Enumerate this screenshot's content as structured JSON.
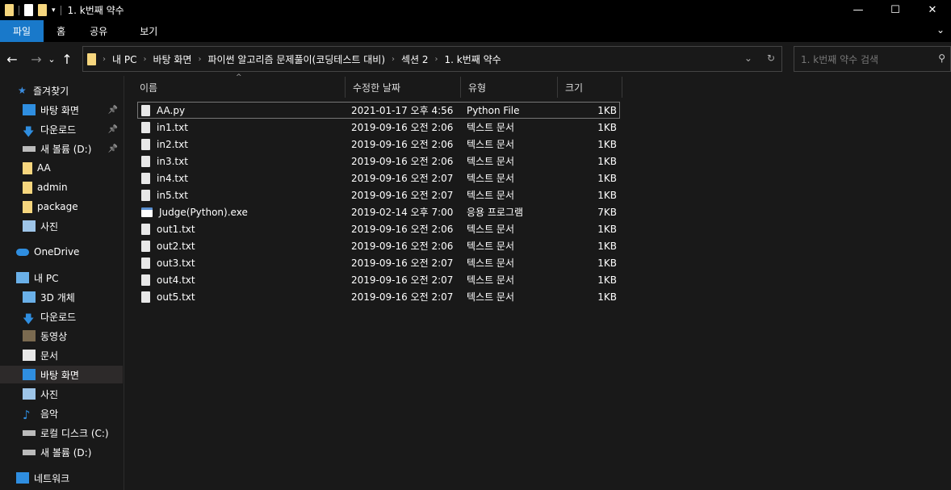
{
  "window": {
    "title": "1. k번째 약수",
    "minimize": "—",
    "maximize": "☐",
    "close": "✕"
  },
  "ribbon": {
    "tabs": [
      "파일",
      "홈",
      "공유",
      "보기"
    ],
    "expand": "⌄"
  },
  "nav": {
    "back": "←",
    "forward": "→",
    "recent": "⌄",
    "up": "↑"
  },
  "address": {
    "crumbs": [
      "내 PC",
      "바탕 화면",
      "파이썬 알고리즘 문제풀이(코딩테스트 대비)",
      "섹션 2",
      "1. k번째 약수"
    ],
    "dropdown": "⌄",
    "refresh": "↻"
  },
  "search": {
    "placeholder": "1. k번째 약수 검색",
    "icon": "⚲"
  },
  "sidebar": {
    "quick_access": "즐겨찾기",
    "quick_items": [
      "바탕 화면",
      "다운로드",
      "새 볼륨 (D:)",
      "AA",
      "admin",
      "package",
      "사진"
    ],
    "onedrive": "OneDrive",
    "this_pc": "내 PC",
    "pc_items": [
      "3D 개체",
      "다운로드",
      "동영상",
      "문서",
      "바탕 화면",
      "사진",
      "음악",
      "로컬 디스크 (C:)",
      "새 볼륨 (D:)"
    ],
    "network": "네트워크",
    "selected": "바탕 화면"
  },
  "columns": [
    "이름",
    "수정한 날짜",
    "유형",
    "크기"
  ],
  "files": [
    {
      "name": "AA.py",
      "date": "2021-01-17 오후 4:56",
      "type": "Python File",
      "size": "1KB",
      "icon": "file"
    },
    {
      "name": "in1.txt",
      "date": "2019-09-16 오전 2:06",
      "type": "텍스트 문서",
      "size": "1KB",
      "icon": "text"
    },
    {
      "name": "in2.txt",
      "date": "2019-09-16 오전 2:06",
      "type": "텍스트 문서",
      "size": "1KB",
      "icon": "text"
    },
    {
      "name": "in3.txt",
      "date": "2019-09-16 오전 2:06",
      "type": "텍스트 문서",
      "size": "1KB",
      "icon": "text"
    },
    {
      "name": "in4.txt",
      "date": "2019-09-16 오전 2:07",
      "type": "텍스트 문서",
      "size": "1KB",
      "icon": "text"
    },
    {
      "name": "in5.txt",
      "date": "2019-09-16 오전 2:07",
      "type": "텍스트 문서",
      "size": "1KB",
      "icon": "text"
    },
    {
      "name": "Judge(Python).exe",
      "date": "2019-02-14 오후 7:00",
      "type": "응용 프로그램",
      "size": "7KB",
      "icon": "exe"
    },
    {
      "name": "out1.txt",
      "date": "2019-09-16 오전 2:06",
      "type": "텍스트 문서",
      "size": "1KB",
      "icon": "text"
    },
    {
      "name": "out2.txt",
      "date": "2019-09-16 오전 2:06",
      "type": "텍스트 문서",
      "size": "1KB",
      "icon": "text"
    },
    {
      "name": "out3.txt",
      "date": "2019-09-16 오전 2:07",
      "type": "텍스트 문서",
      "size": "1KB",
      "icon": "text"
    },
    {
      "name": "out4.txt",
      "date": "2019-09-16 오전 2:07",
      "type": "텍스트 문서",
      "size": "1KB",
      "icon": "text"
    },
    {
      "name": "out5.txt",
      "date": "2019-09-16 오전 2:07",
      "type": "텍스트 문서",
      "size": "1KB",
      "icon": "text"
    }
  ],
  "colors": {
    "accent": "#1979ca",
    "folder": "#f6d67e",
    "background": "#191919"
  }
}
